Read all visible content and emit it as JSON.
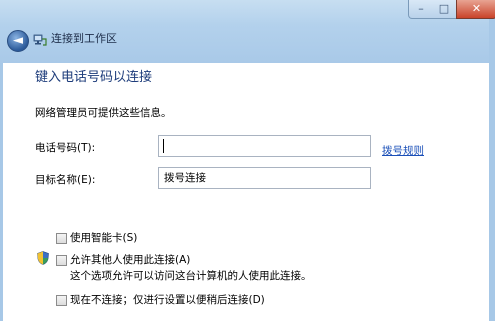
{
  "window": {
    "title": "连接到工作区",
    "controls": {
      "minimize": "–",
      "maximize": "□",
      "close": "✕"
    },
    "back_glyph": "◄"
  },
  "page": {
    "heading": "键入电话号码以连接",
    "description": "网络管理员可提供这些信息。",
    "phone_label": "电话号码(T):",
    "phone_value": "",
    "dialing_rules_link": "拨号规则",
    "destination_label": "目标名称(E):",
    "destination_value": "拨号连接"
  },
  "options": {
    "smart_card": {
      "label": "使用智能卡(S)",
      "checked": false
    },
    "allow_others": {
      "label": "允许其他人使用此连接(A)",
      "checked": false,
      "icon": "uac-shield-icon"
    },
    "allow_others_note": "这个选项允许可以访问这台计算机的人使用此连接。",
    "dont_connect": {
      "label": "现在不连接；仅进行设置以便稍后连接(D)",
      "checked": false
    }
  },
  "colors": {
    "heading": "#1c3b7a",
    "link": "#1a4fb8",
    "frame": "#b3d1ec"
  }
}
